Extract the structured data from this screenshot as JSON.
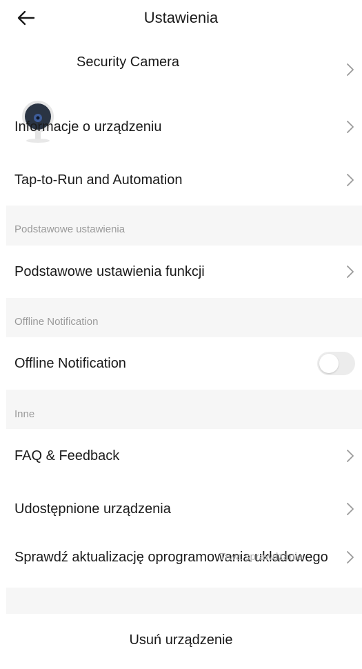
{
  "header": {
    "back_icon": "arrow-left-icon",
    "title": "Ustawienia"
  },
  "device": {
    "name": "Security Camera",
    "icon": "security-camera-image"
  },
  "rows": {
    "device_info": "Informacje o urządzeniu",
    "tap_to_run": "Tap-to-Run and Automation",
    "basic_settings": "Podstawowe ustawienia funkcji",
    "offline_notification": "Offline Notification",
    "faq": "FAQ & Feedback",
    "shared_devices": "Udostępnione urządzenia",
    "firmware_update": "Sprawdź aktualizację oprogramowania układowego"
  },
  "sections": {
    "basic": "Podstawowe ustawienia",
    "offline": "Offline Notification",
    "other": "Inne"
  },
  "offline_toggle": {
    "enabled": false
  },
  "firmware_overlay_text": "Trwa sprawdzanie",
  "delete_button": "Usuń urządzenie",
  "colors": {
    "background": "#ffffff",
    "section_background": "#f6f6f6",
    "text": "#1a1a1a",
    "section_label": "#9a9a9a",
    "toggle_off": "#ececec"
  }
}
